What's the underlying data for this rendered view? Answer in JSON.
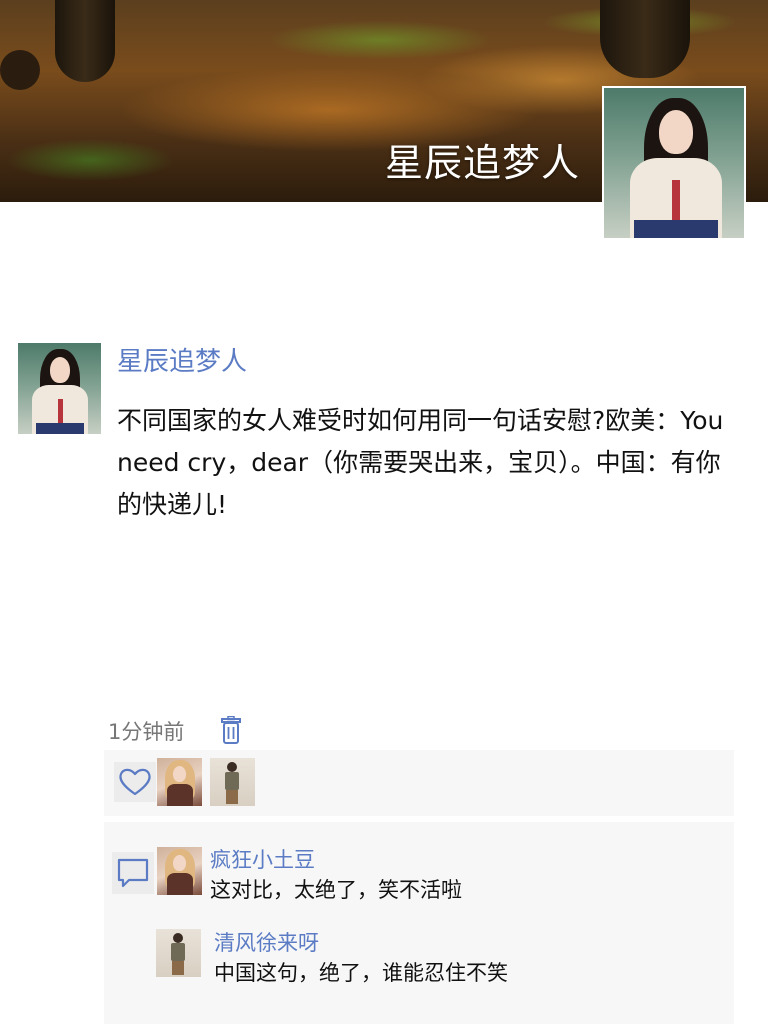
{
  "profile": {
    "name": "星辰追梦人",
    "cover_image": "autumn-forest-cover",
    "avatar_image": "hanbok-portrait-avatar"
  },
  "post": {
    "author": "星辰追梦人",
    "text": "不同国家的女人难受时如何用同一句话安慰?欧美：You need cry，dear（你需要哭出来，宝贝）。中国：有你的快递儿!",
    "time": "1分钟前"
  },
  "icons": {
    "delete": "trash-icon",
    "like": "heart-icon",
    "comment": "comment-bubble-icon"
  },
  "likes": {
    "avatars": [
      "blonde-woman-avatar",
      "standing-woman-avatar"
    ]
  },
  "comments": [
    {
      "author": "疯狂小土豆",
      "text": "这对比，太绝了，笑不活啦",
      "avatar": "blonde-woman-avatar"
    },
    {
      "author": "清风徐来呀",
      "text": "中国这句，绝了，谁能忍住不笑",
      "avatar": "standing-woman-avatar"
    }
  ],
  "colors": {
    "accent": "#5b7cc4",
    "panel_background": "#f7f7f7",
    "text": "#111111",
    "muted": "#777777"
  }
}
